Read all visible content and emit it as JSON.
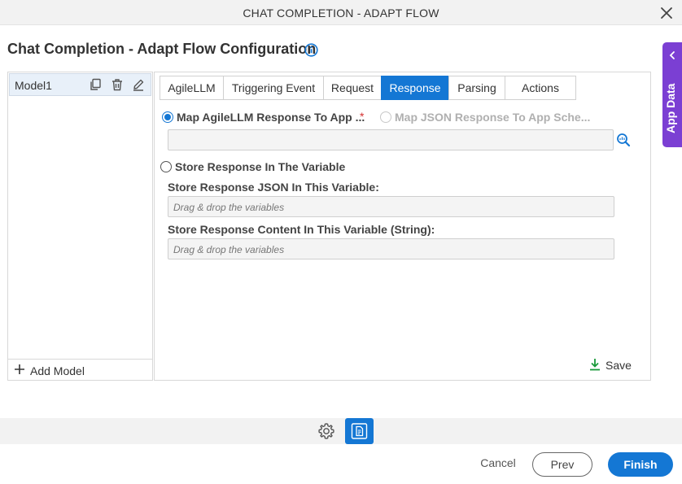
{
  "window": {
    "title": "CHAT COMPLETION - ADAPT FLOW"
  },
  "page": {
    "heading": "Chat Completion - Adapt Flow Configuration"
  },
  "app_data_panel": {
    "label": "App Data"
  },
  "models": {
    "items": [
      {
        "name": "Model1"
      }
    ],
    "add_label": "Add Model"
  },
  "tabs": [
    {
      "label": "AgileLLM",
      "active": false
    },
    {
      "label": "Triggering Event",
      "active": false
    },
    {
      "label": "Request",
      "active": false
    },
    {
      "label": "Response",
      "active": true
    },
    {
      "label": "Parsing",
      "active": false
    },
    {
      "label": "Actions",
      "active": false
    }
  ],
  "response": {
    "option_map_agilellm": {
      "label": "Map AgileLLM Response To App ...",
      "checked": true,
      "required_mark": "*"
    },
    "option_map_json": {
      "label": "Map JSON Response To App Sche...",
      "checked": false,
      "disabled": true
    },
    "app_schema_field": {
      "value": ""
    },
    "option_store_variable": {
      "label": "Store Response In The Variable",
      "checked": false
    },
    "store_json": {
      "label": "Store Response JSON In This Variable:",
      "placeholder": "Drag & drop the variables"
    },
    "store_content": {
      "label": "Store Response Content In This Variable (String):",
      "placeholder": "Drag & drop the variables"
    },
    "save_label": "Save"
  },
  "footer": {
    "cancel_label": "Cancel",
    "prev_label": "Prev",
    "finish_label": "Finish"
  },
  "colors": {
    "accent": "#1477d4",
    "app_data": "#7b3fd3",
    "required": "#d43030"
  }
}
